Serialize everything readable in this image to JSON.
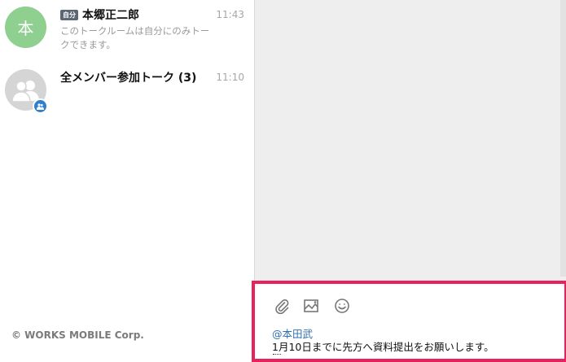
{
  "talk_list": [
    {
      "avatar_letter": "本",
      "avatar_color": "#8fcf8f",
      "badge": "自分",
      "name": "本郷正二郎",
      "time": "11:43",
      "preview": "このトークルームは自分にのみトークできます。"
    },
    {
      "avatar_color": "#d5d5d5",
      "name": "全メンバー参加トーク (3)",
      "time": "11:10"
    }
  ],
  "footer": {
    "copyright": "© WORKS MOBILE Corp."
  },
  "composer": {
    "icons": [
      "attach-icon",
      "image-icon",
      "emoji-icon"
    ],
    "mention": "@本田武",
    "message": "1月10日までに先方へ資料提出をお願いします。",
    "highlight_color": "#e8215f"
  }
}
